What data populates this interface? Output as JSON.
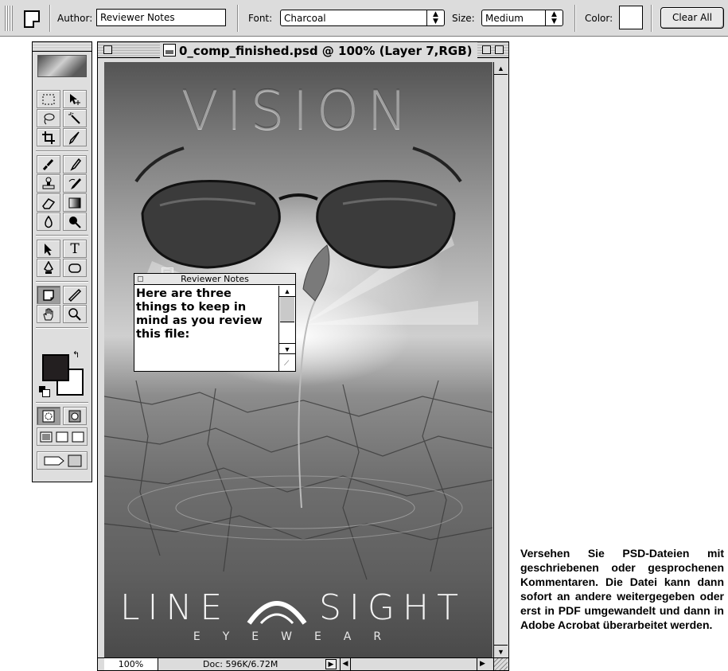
{
  "options_bar": {
    "author_label": "Author:",
    "author_value": "Reviewer Notes",
    "font_label": "Font:",
    "font_value": "Charcoal",
    "size_label": "Size:",
    "size_value": "Medium",
    "color_label": "Color:",
    "color_value": "#ffffff",
    "clear_all_label": "Clear All"
  },
  "toolbox": {
    "foreground_color": "#231f20",
    "background_color": "#ffffff",
    "tools": [
      {
        "name": "marquee-icon"
      },
      {
        "name": "move-icon"
      },
      {
        "name": "lasso-icon"
      },
      {
        "name": "magic-wand-icon"
      },
      {
        "name": "crop-icon"
      },
      {
        "name": "slice-icon"
      },
      {
        "name": "healing-brush-icon"
      },
      {
        "name": "brush-icon"
      },
      {
        "name": "clone-stamp-icon"
      },
      {
        "name": "history-brush-icon"
      },
      {
        "name": "eraser-icon"
      },
      {
        "name": "gradient-icon"
      },
      {
        "name": "blur-icon"
      },
      {
        "name": "dodge-icon"
      },
      {
        "name": "path-selection-icon"
      },
      {
        "name": "type-tool-icon",
        "glyph": "T"
      },
      {
        "name": "pen-icon"
      },
      {
        "name": "shape-icon"
      },
      {
        "name": "notes-icon"
      },
      {
        "name": "eyedropper-icon"
      },
      {
        "name": "hand-icon"
      },
      {
        "name": "zoom-icon"
      }
    ]
  },
  "document": {
    "title": "0_comp_finished.psd @ 100% (Layer 7,RGB)",
    "headline": "VISION",
    "brand_left": "LINE",
    "brand_right": "SIGHT",
    "brand_sub": "EYEWEAR",
    "zoom": "100%",
    "doc_info": "Doc: 596K/6.72M"
  },
  "note": {
    "title": "Reviewer Notes",
    "body": "Here are three\nthings to keep in\nmind as you review\nthis file:"
  },
  "caption": "Versehen Sie PSD-Dateien mit geschriebenen oder gesproche­nen Kommentaren. Die Datei kann dann sofort an andere weitergegeben oder erst in PDF umgewandelt und dann in Adobe Acrobat überarbeitet werden."
}
